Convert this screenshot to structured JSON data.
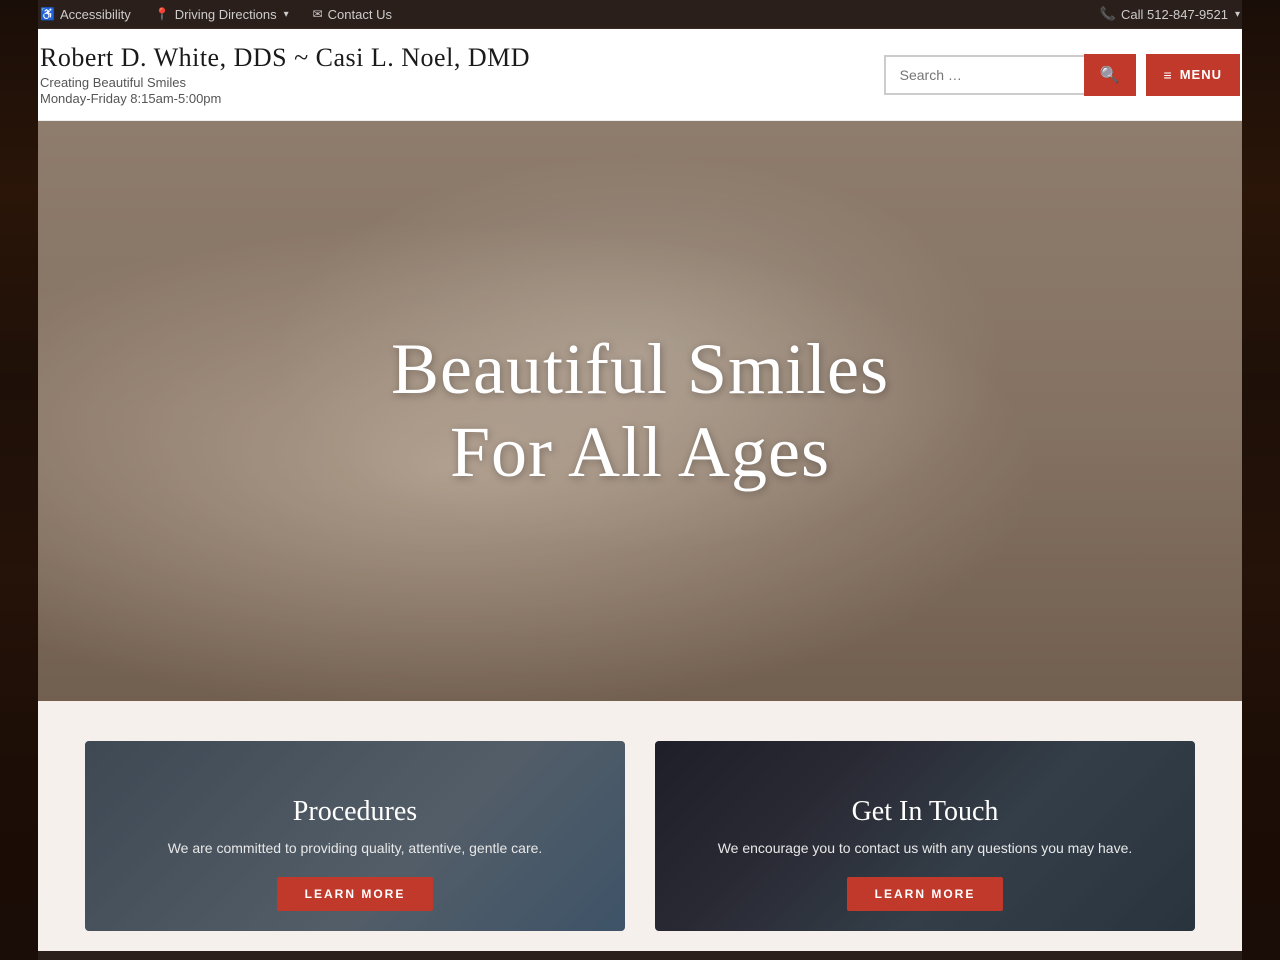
{
  "topbar": {
    "accessibility_label": "Accessibility",
    "accessibility_icon": "♿",
    "directions_label": "Driving Directions",
    "directions_icon": "📍",
    "directions_chevron": "▾",
    "contact_label": "Contact Us",
    "contact_icon": "✉",
    "call_label": "Call 512-847-9521",
    "call_icon": "📞",
    "call_chevron": "▾"
  },
  "header": {
    "site_title": "Robert D. White, DDS ~ Casi L. Noel, DMD",
    "tagline": "Creating Beautiful Smiles",
    "hours": "Monday-Friday 8:15am-5:00pm",
    "search_placeholder": "Search …",
    "menu_label": "MENU",
    "menu_icon": "≡"
  },
  "hero": {
    "headline_line1": "Beautiful Smiles",
    "headline_line2": "For All Ages"
  },
  "cards": [
    {
      "id": "procedures",
      "title": "Procedures",
      "description": "We are committed to providing quality, attentive, gentle care.",
      "button_label": "LEARN MORE"
    },
    {
      "id": "contact",
      "title": "Get In Touch",
      "description": "We encourage you to contact us with any questions you may have.",
      "button_label": "LEARN MORE"
    }
  ]
}
